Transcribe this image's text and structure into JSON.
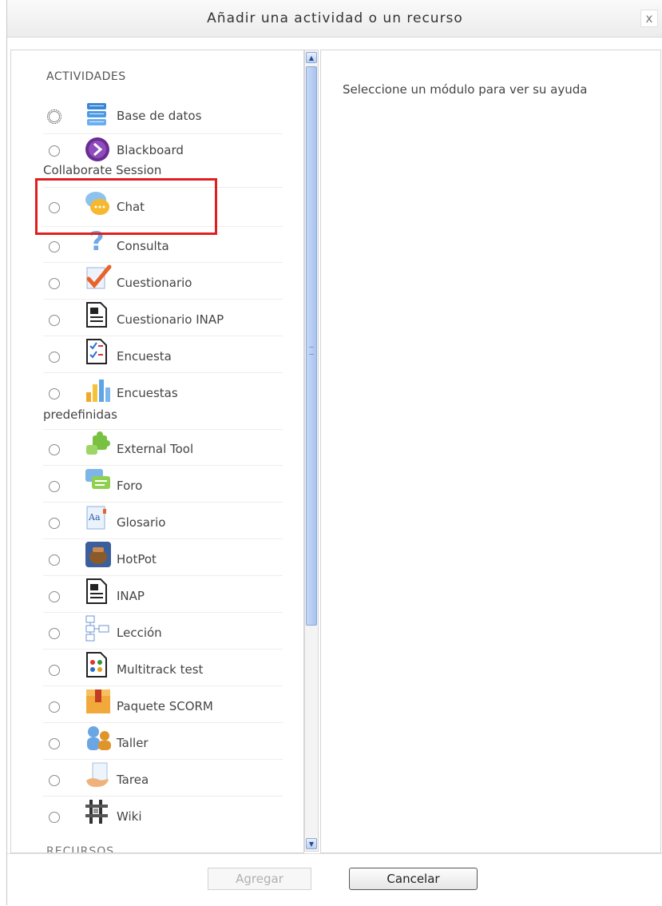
{
  "dialog": {
    "title": "Añadir una actividad o un recurso",
    "close_label": "x"
  },
  "activities": {
    "section_title": "ACTIVIDADES",
    "items": [
      {
        "label": "Base de datos",
        "icon": "database-icon"
      },
      {
        "label": "Blackboard",
        "label2": "Collaborate Session",
        "icon": "blackboard-collaborate-icon",
        "highlighted": true
      },
      {
        "label": "Chat",
        "icon": "chat-icon"
      },
      {
        "label": "Consulta",
        "icon": "question-icon"
      },
      {
        "label": "Cuestionario",
        "icon": "checkmark-icon"
      },
      {
        "label": "Cuestionario INAP",
        "icon": "document-icon"
      },
      {
        "label": "Encuesta",
        "icon": "survey-icon"
      },
      {
        "label": "Encuestas",
        "label2": "predefinidas",
        "icon": "bar-chart-icon"
      },
      {
        "label": "External Tool",
        "icon": "puzzle-icon"
      },
      {
        "label": "Foro",
        "icon": "forum-icon"
      },
      {
        "label": "Glosario",
        "icon": "glossary-icon"
      },
      {
        "label": "HotPot",
        "icon": "hotpot-icon"
      },
      {
        "label": "INAP",
        "icon": "document-icon"
      },
      {
        "label": "Lección",
        "icon": "lesson-icon"
      },
      {
        "label": "Multitrack test",
        "icon": "multitrack-icon"
      },
      {
        "label": "Paquete SCORM",
        "icon": "scorm-package-icon"
      },
      {
        "label": "Taller",
        "icon": "workshop-icon"
      },
      {
        "label": "Tarea",
        "icon": "assignment-icon"
      },
      {
        "label": "Wiki",
        "icon": "wiki-icon"
      }
    ]
  },
  "resources": {
    "section_title": "RECURSOS"
  },
  "help": {
    "text": "Seleccione un módulo para ver su ayuda"
  },
  "footer": {
    "add_label": "Agregar",
    "cancel_label": "Cancelar"
  },
  "colors": {
    "highlight_border": "#e02020",
    "scrollbar_thumb": "#aac4ee"
  }
}
